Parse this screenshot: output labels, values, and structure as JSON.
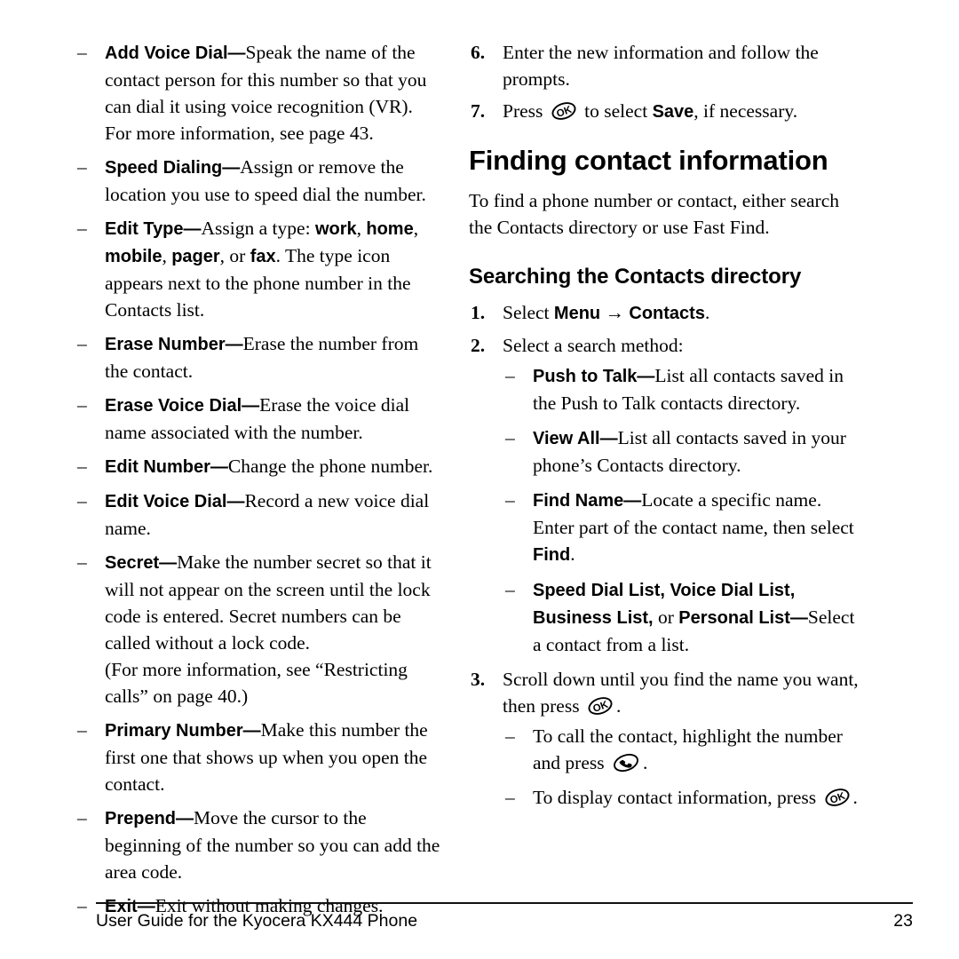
{
  "document": {
    "title": "Kyocera KX444 Phone User Guide",
    "footer": {
      "text": "User Guide for the Kyocera KX444 Phone",
      "page_number": "23"
    }
  },
  "left_column": {
    "dash": "–",
    "items": [
      {
        "label": "Add Voice Dial",
        "separator": "—",
        "body": "Speak the name of the contact person for this number so that you can dial it using voice recognition (VR). For more information, see page 43."
      },
      {
        "label": "Speed Dialing",
        "separator": "—",
        "body": "Assign or remove the location you use to speed dial the number."
      },
      {
        "label": "Edit Type",
        "separator": "—",
        "body_pre": "Assign a type: ",
        "inline_bold": [
          "work",
          "home",
          "mobile",
          "pager",
          "fax"
        ],
        "body_post": "The type icon appears next to the phone number in the Contacts list."
      },
      {
        "label": "Erase Number",
        "separator": "—",
        "body": "Erase the number from the contact."
      },
      {
        "label": "Erase Voice Dial",
        "separator": "—",
        "body": "Erase the voice dial name associated with the number."
      },
      {
        "label": "Edit Number",
        "separator": "—",
        "body": "Change the phone number."
      },
      {
        "label": "Edit Voice Dial",
        "separator": "—",
        "body": "Record a new voice dial name."
      },
      {
        "label": "Secret",
        "separator": "—",
        "body": "Make the number secret so that it will not appear on the screen until the lock code is entered. Secret numbers can be called without a lock code.",
        "body_second": "(For more information, see “Restricting calls” on page 40.)"
      },
      {
        "label": "Primary Number",
        "separator": "—",
        "body": "Make this number the first one that shows up when you open the contact."
      },
      {
        "label": "Prepend",
        "separator": "—",
        "body": "Move the cursor to the beginning of the number so you can add the area code."
      },
      {
        "label": "Exit",
        "separator": "—",
        "body": "Exit without making changes."
      }
    ]
  },
  "right_column": {
    "dash": "–",
    "arrow": "→",
    "steps_top": [
      {
        "number": "6.",
        "text": "Enter the new information and follow the prompts."
      },
      {
        "number": "7.",
        "pre": "Press ",
        "icon": "ok-key-icon",
        "mid": " to select ",
        "bold": "Save",
        "post": ", if necessary."
      }
    ],
    "heading_major": "Finding contact information",
    "intro": "To find a phone number or contact, either search the Contacts directory or use Fast Find.",
    "heading_minor": "Searching the Contacts directory",
    "steps": [
      {
        "number": "1.",
        "pre": "Select ",
        "bold1": "Menu",
        "arrow": "→",
        "bold2": "Contacts",
        "post": "."
      },
      {
        "number": "2.",
        "text": "Select a search method:"
      },
      {
        "number": "3.",
        "pre": "Scroll down until you find the name you want, then press ",
        "icon": "ok-key-icon",
        "post": "."
      }
    ],
    "search_methods": [
      {
        "label": "Push to Talk",
        "separator": "—",
        "body": "List all contacts saved in the Push to Talk contacts directory."
      },
      {
        "label": "View All",
        "separator": "—",
        "body": "List all contacts saved in your phone’s Contacts directory."
      },
      {
        "label": "Find Name",
        "separator": "—",
        "body_pre": "Locate a specific name. Enter part of the contact name, then select ",
        "bold_end": "Find",
        "body_post": "."
      },
      {
        "label": "Speed Dial List, Voice Dial List, Business List,",
        "mid": " or ",
        "label2": "Personal List",
        "separator": "—",
        "body": "Select a contact from a list."
      }
    ],
    "sub_steps": [
      {
        "pre": "To call the contact, highlight the number and press ",
        "icon": "send-key-icon",
        "post": "."
      },
      {
        "pre": "To display contact information, press ",
        "icon": "ok-key-icon",
        "post": "."
      }
    ]
  },
  "icons": {
    "ok_key": "OK",
    "send_key": "phone-handset"
  },
  "colors": {
    "text": "#000000",
    "background": "#ffffff",
    "rule": "#111111"
  }
}
